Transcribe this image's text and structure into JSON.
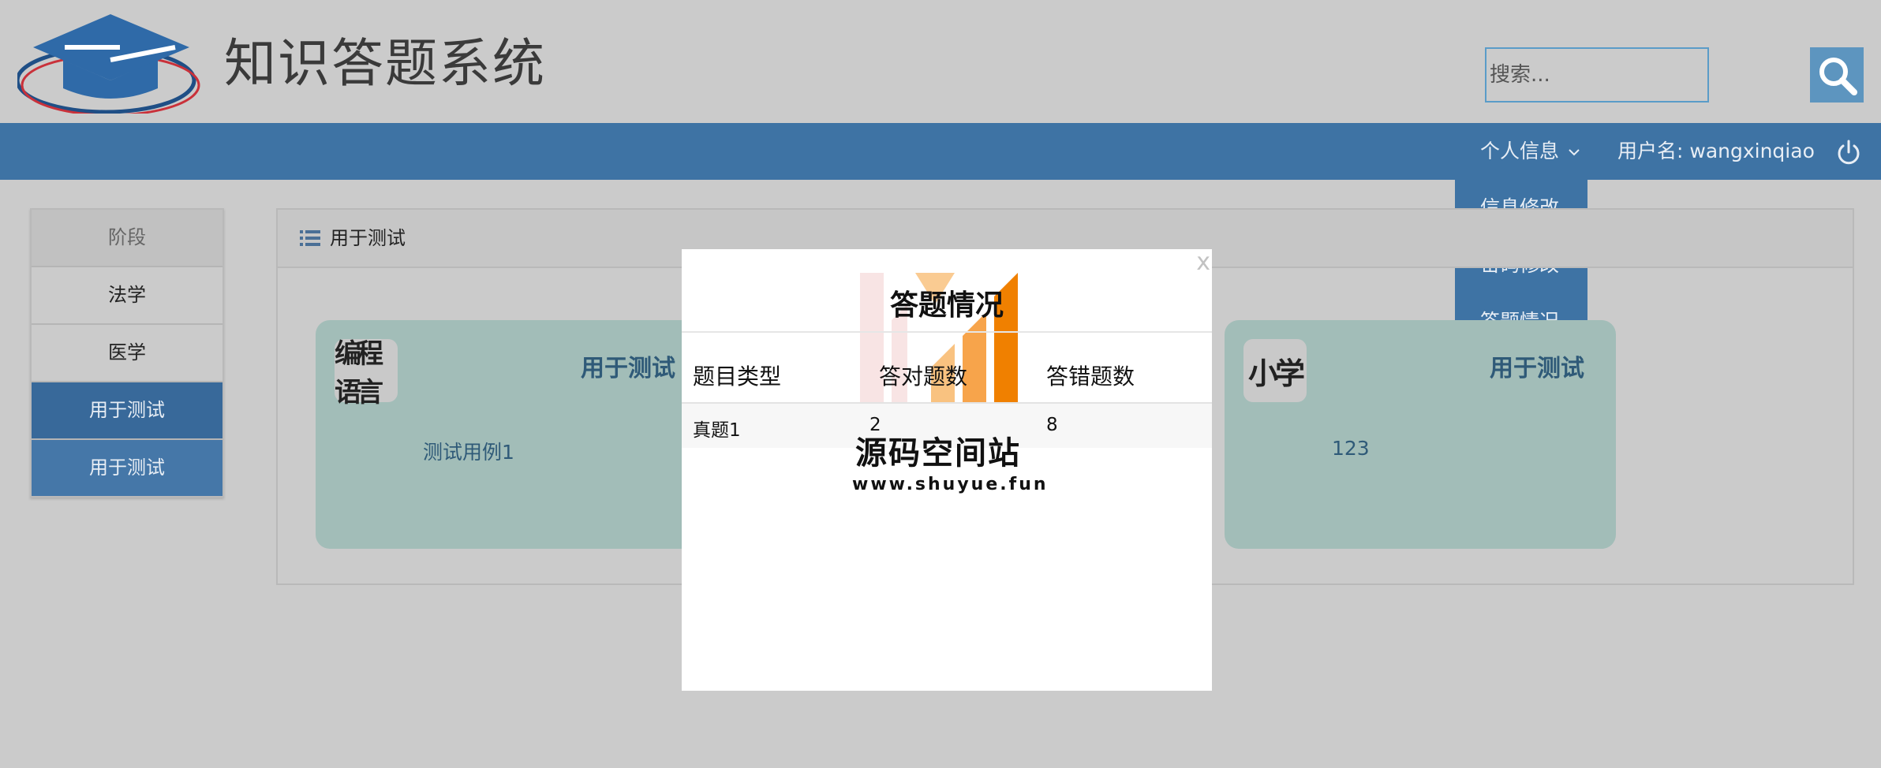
{
  "header": {
    "title": "知识答题系统",
    "search": {
      "placeholder": "搜索..."
    }
  },
  "nav": {
    "personal_info": "个人信息",
    "username_label": "用户名: wangxinqiao",
    "dropdown": [
      "信息修改",
      "密码修改",
      "答题情况"
    ]
  },
  "sidebar": {
    "items": [
      {
        "label": "阶段"
      },
      {
        "label": "法学"
      },
      {
        "label": "医学"
      },
      {
        "label": "用于测试"
      },
      {
        "label": "用于测试"
      }
    ]
  },
  "main": {
    "panel_title": "用于测试",
    "cards": [
      {
        "icon_text": "编程语言",
        "title": "用于测试",
        "desc": "测试用例1"
      },
      {
        "icon_text": "小学",
        "title": "用于测试",
        "desc": "123"
      }
    ]
  },
  "modal": {
    "close": "x",
    "title": "答题情况",
    "columns": [
      "题目类型",
      "答对题数",
      "答错题数"
    ],
    "rows": [
      [
        "真题1",
        "2",
        "8"
      ]
    ]
  },
  "watermark": {
    "text": "源码空间站",
    "url": "www.shuyue.fun"
  },
  "colors": {
    "nav": "#3e73a4",
    "card": "#a2bdb8",
    "sidebar_active": "#38699a"
  },
  "icons": [
    "graduation-cap-logo",
    "search-icon",
    "chevron-down-icon",
    "power-icon",
    "list-icon"
  ]
}
